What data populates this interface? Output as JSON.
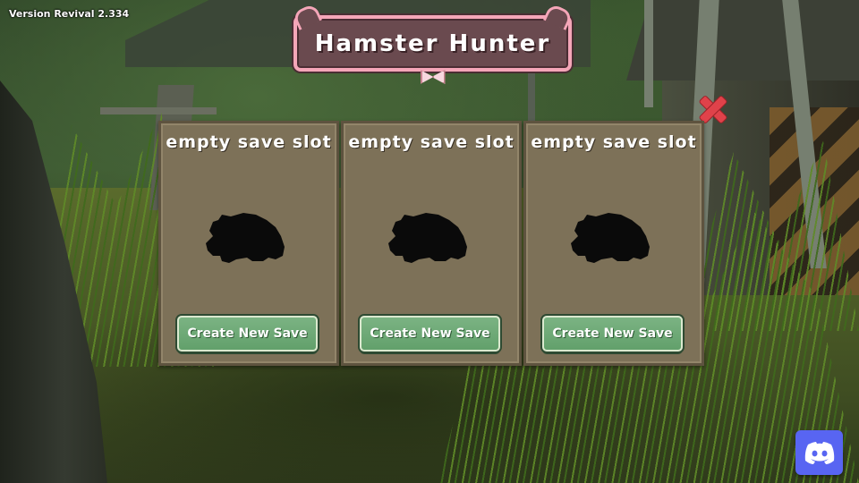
{
  "version": "Version Revival 2.334",
  "title": "Hamster Hunter",
  "slots": [
    {
      "label": "empty save slot",
      "button": "Create New Save"
    },
    {
      "label": "empty save slot",
      "button": "Create New Save"
    },
    {
      "label": "empty save slot",
      "button": "Create New Save"
    }
  ],
  "colors": {
    "slot_panel": "#7d7158",
    "button_green": "#62a06b",
    "title_border": "#f4a6b8",
    "close_red": "#e0424a",
    "discord_blue": "#5865f2"
  },
  "icons": {
    "close": "close-icon",
    "discord": "discord-icon",
    "hamster": "hamster-silhouette-icon"
  }
}
